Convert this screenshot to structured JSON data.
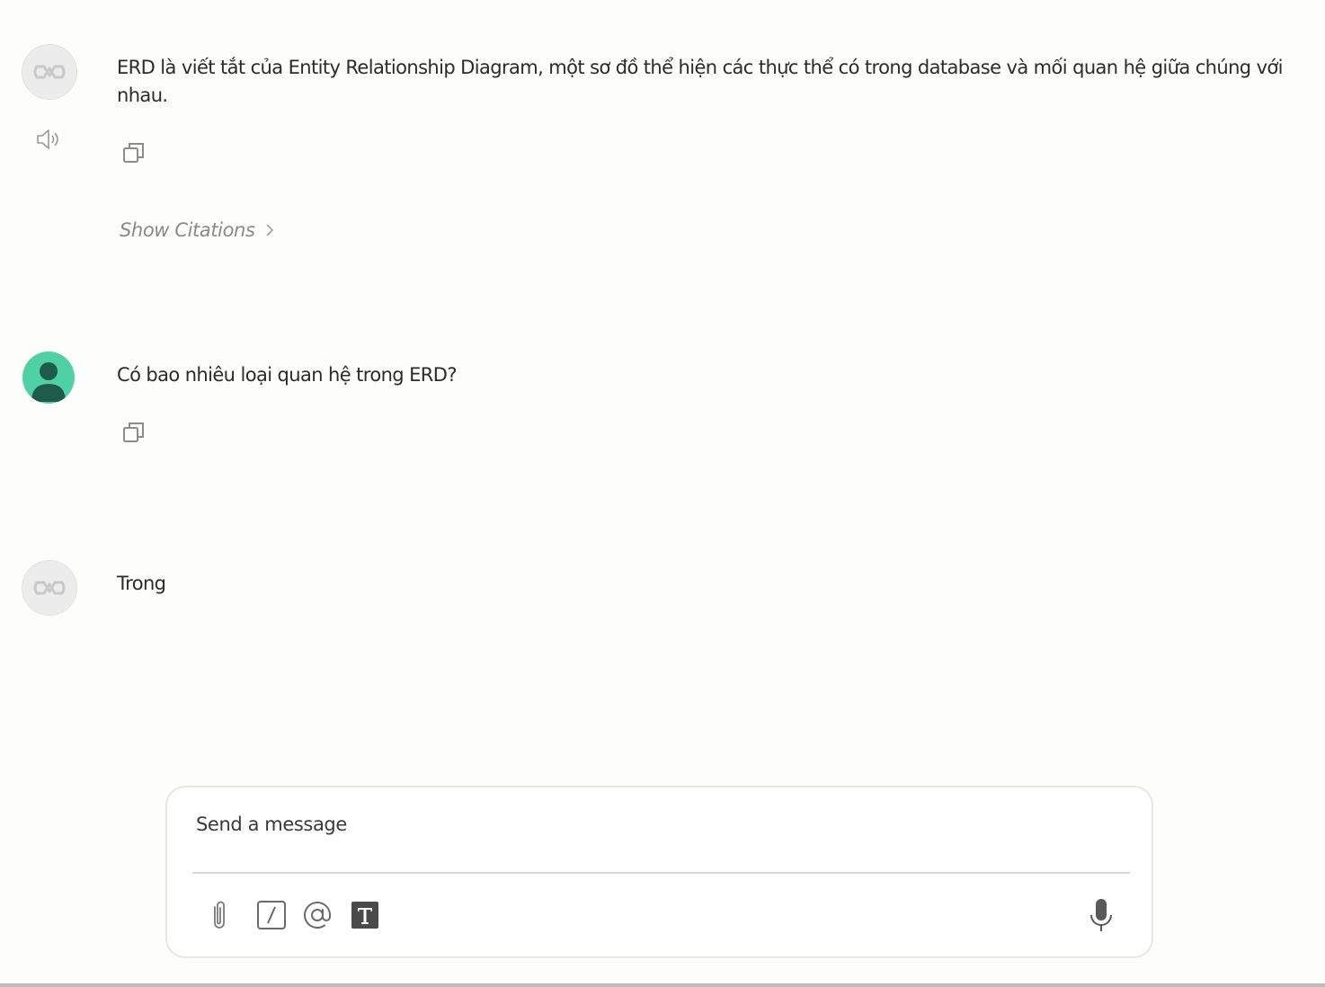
{
  "conversation": {
    "messages": [
      {
        "role": "assistant",
        "avatar_icon": "bot-logo-icon",
        "text": "ERD là viết tắt của Entity Relationship Diagram, một sơ đồ thể hiện các thực thể có trong database và mối quan hệ giữa chúng với nhau.",
        "actions": [
          "speaker-icon",
          "copy-icon"
        ],
        "citations_label": "Show Citations"
      },
      {
        "role": "user",
        "avatar_icon": "user-icon",
        "text": "Có bao nhiêu loại quan hệ trong ERD?",
        "actions": [
          "copy-icon"
        ]
      },
      {
        "role": "assistant",
        "avatar_icon": "bot-logo-icon",
        "text": "Trong"
      }
    ]
  },
  "composer": {
    "placeholder": "Send a message",
    "value": "",
    "tools": [
      "paperclip-icon",
      "slash-command-icon",
      "mention-icon",
      "text-format-icon"
    ],
    "voice_icon": "microphone-icon"
  },
  "colors": {
    "background": "#fdfdfc",
    "user_avatar": "#4fd1a5",
    "user_avatar_figure": "#1f5b4a",
    "citations_text": "#8a8a8a"
  }
}
